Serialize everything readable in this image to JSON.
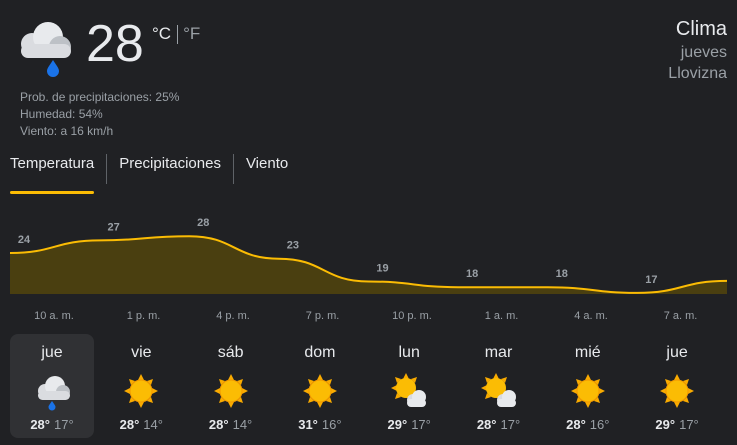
{
  "current": {
    "icon": "cloud-rain-icon",
    "temp": "28",
    "unit_c": "°C",
    "unit_f": "°F",
    "precip": "Prob. de precipitaciones: 25%",
    "humidity": "Humedad: 54%",
    "wind": "Viento: a 16 km/h"
  },
  "header": {
    "title": "Clima",
    "day": "jueves",
    "condition": "Llovizna"
  },
  "tabs": [
    {
      "label": "Temperatura",
      "active": true
    },
    {
      "label": "Precipitaciones",
      "active": false
    },
    {
      "label": "Viento",
      "active": false
    }
  ],
  "chart_data": {
    "type": "area",
    "x": [
      "10 a. m.",
      "1 p. m.",
      "4 p. m.",
      "7 p. m.",
      "10 p. m.",
      "1 a. m.",
      "4 a. m.",
      "7 a. m."
    ],
    "values": [
      24,
      27,
      28,
      23,
      19,
      18,
      18,
      17
    ],
    "labels": [
      "24",
      "27",
      "28",
      "23",
      "19",
      "18",
      "18",
      "17"
    ],
    "color": "#fbbc04",
    "fill": "#4a3f10"
  },
  "days": [
    {
      "name": "jue",
      "icon": "cloud-rain-icon",
      "high": "28°",
      "low": "17°",
      "selected": true
    },
    {
      "name": "vie",
      "icon": "sun-icon",
      "high": "28°",
      "low": "14°",
      "selected": false
    },
    {
      "name": "sáb",
      "icon": "sun-icon",
      "high": "28°",
      "low": "14°",
      "selected": false
    },
    {
      "name": "dom",
      "icon": "sun-icon",
      "high": "31°",
      "low": "16°",
      "selected": false
    },
    {
      "name": "lun",
      "icon": "partly-cloudy-icon",
      "high": "29°",
      "low": "17°",
      "selected": false
    },
    {
      "name": "mar",
      "icon": "partly-cloudy-icon",
      "high": "28°",
      "low": "17°",
      "selected": false
    },
    {
      "name": "mié",
      "icon": "sun-icon",
      "high": "28°",
      "low": "16°",
      "selected": false
    },
    {
      "name": "jue",
      "icon": "sun-icon",
      "high": "29°",
      "low": "17°",
      "selected": false
    }
  ]
}
